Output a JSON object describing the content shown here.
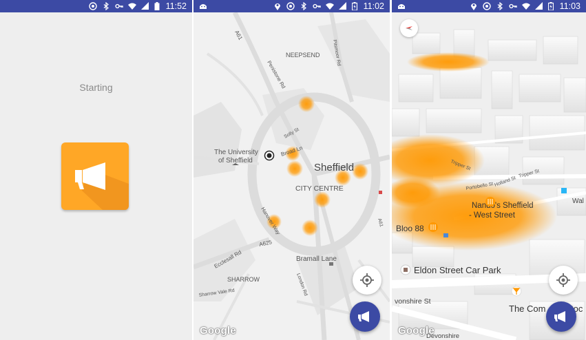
{
  "colors": {
    "status_bar": "#3c4aa4",
    "accent_orange": "#ffa726",
    "heat": "#ff9800",
    "fab": "#3c4aa4"
  },
  "screen1": {
    "status": {
      "time": "11:52",
      "icons": [
        "cast-icon",
        "bluetooth-icon",
        "vpn-key-icon",
        "wifi-icon",
        "signal-icon",
        "battery-icon"
      ]
    },
    "loading_text": "Starting",
    "logo_icon": "megaphone-icon"
  },
  "screen2": {
    "status": {
      "time": "11:02",
      "icons": [
        "android-icon",
        "location-icon",
        "cast-icon",
        "bluetooth-icon",
        "vpn-key-icon",
        "wifi-icon",
        "signal-icon",
        "battery-charging-icon"
      ]
    },
    "labels": {
      "a61": "A61",
      "neepsend": "NEEPSEND",
      "pitsmoor": "Pitsmoor Rd",
      "penistone": "Penistone Rd",
      "solly": "Solly St",
      "broad": "Broad Ln",
      "university": "The University",
      "of_sheffield": "of Sheffield",
      "sheffield": "Sheffield",
      "city_centre": "CITY CENTRE",
      "hanover": "Hanover Way",
      "a625": "A625",
      "ecclesall": "Ecclesall Rd",
      "bramall": "Bramall Lane",
      "sharrow": "SHARROW",
      "sharrow_vale": "Sharrow Vale Rd",
      "london": "London Rd",
      "a61b": "A61"
    },
    "watermark": "Google",
    "heat_spots": 8
  },
  "screen3": {
    "status": {
      "time": "11:03",
      "icons": [
        "android-icon",
        "location-icon",
        "cast-icon",
        "bluetooth-icon",
        "vpn-key-icon",
        "wifi-icon",
        "signal-icon",
        "battery-charging-icon"
      ]
    },
    "labels": {
      "nandos1": "Nando's Sheffield",
      "nandos2": "- West Street",
      "bloo": "Bloo 88",
      "eldon": "Eldon Street Car Park",
      "devonshire": "vonshire St",
      "devonshire2": "Devonshire",
      "portobello": "Portobello St",
      "holland": "Holland St",
      "tripper": "Tripper St",
      "wal": "Wal",
      "the_com": "The Com",
      "pod": "Poc"
    },
    "watermark": "Google"
  }
}
